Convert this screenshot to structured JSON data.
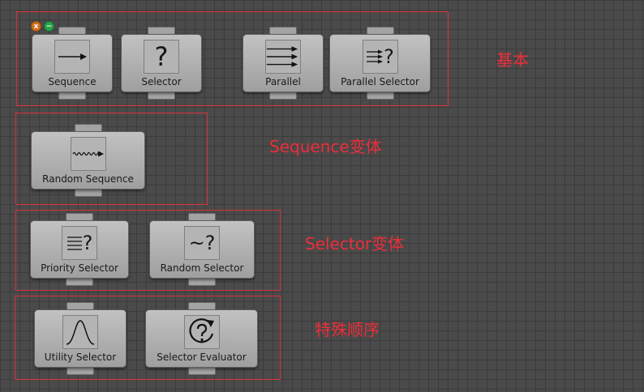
{
  "controls": {
    "close_glyph": "x",
    "minimize_glyph": "−",
    "close_color": "#d0701c",
    "minimize_color": "#2aa14a"
  },
  "groups": [
    {
      "label": "基本"
    },
    {
      "label": "Sequence变体"
    },
    {
      "label": "Selector变体"
    },
    {
      "label": "特殊顺序"
    }
  ],
  "nodes": [
    {
      "label": "Sequence",
      "icon": "arrow-right-icon"
    },
    {
      "label": "Selector",
      "icon": "question-mark-icon",
      "glyph": "?"
    },
    {
      "label": "Parallel",
      "icon": "parallel-arrows-icon"
    },
    {
      "label": "Parallel Selector",
      "icon": "parallel-selector-icon",
      "glyph": "?"
    },
    {
      "label": "Random Sequence",
      "icon": "wavy-arrow-icon"
    },
    {
      "label": "Priority Selector",
      "icon": "priority-list-icon",
      "glyph": "?"
    },
    {
      "label": "Random Selector",
      "icon": "random-selector-icon",
      "glyph": "~?"
    },
    {
      "label": "Utility Selector",
      "icon": "bell-curve-icon"
    },
    {
      "label": "Selector Evaluator",
      "icon": "question-cycle-icon"
    }
  ],
  "colors": {
    "frame": "#d9303a",
    "group_label": "#ec2e3b",
    "canvas": "#4a4a4a",
    "node": "#b3b3b3"
  }
}
